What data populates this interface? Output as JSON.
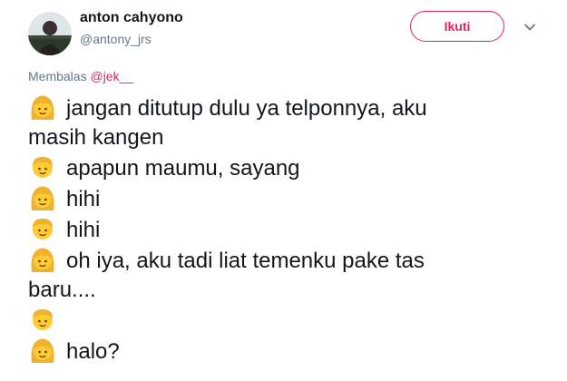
{
  "user": {
    "name": "anton cahyono",
    "handle": "@antony_jrs"
  },
  "follow_label": "Ikuti",
  "reply": {
    "prefix": "Membalas",
    "mention": "@jek__"
  },
  "tweet": {
    "lines": [
      {
        "emoji": "girl-emoji",
        "text": "jangan ditutup dulu ya telponnya, aku"
      },
      {
        "emoji": null,
        "text": "masih kangen"
      },
      {
        "emoji": "boy-emoji",
        "text": "apapun maumu, sayang"
      },
      {
        "emoji": "girl-emoji",
        "text": "hihi"
      },
      {
        "emoji": "boy-emoji",
        "text": "hihi"
      },
      {
        "emoji": "girl-emoji",
        "text": "oh iya, aku tadi liat temenku pake tas"
      },
      {
        "emoji": null,
        "text": "baru...."
      },
      {
        "emoji": "boy-emoji",
        "text": ""
      },
      {
        "emoji": "girl-emoji",
        "text": "halo?"
      }
    ]
  },
  "colors": {
    "accent": "#e0245e",
    "secondary_text": "#657786",
    "primary_text": "#14171a",
    "emoji_yellow": "#ffcc33",
    "emoji_hair": "#f0b030"
  }
}
